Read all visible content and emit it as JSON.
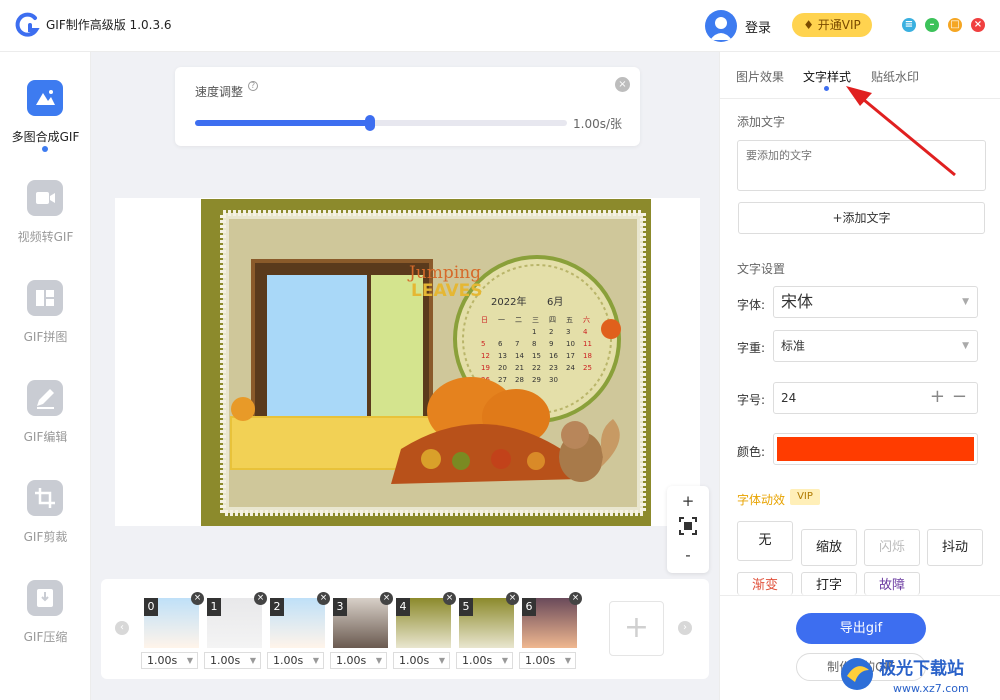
{
  "app": {
    "title": "GIF制作高级版 1.0.3.6",
    "login": "登录",
    "vip_button": "开通VIP"
  },
  "sidebar": {
    "items": [
      {
        "label": "多图合成GIF",
        "icon": "images-icon",
        "active": true
      },
      {
        "label": "视频转GIF",
        "icon": "video-icon",
        "active": false
      },
      {
        "label": "GIF拼图",
        "icon": "collage-icon",
        "active": false
      },
      {
        "label": "GIF编辑",
        "icon": "edit-icon",
        "active": false
      },
      {
        "label": "GIF剪裁",
        "icon": "crop-icon",
        "active": false
      },
      {
        "label": "GIF压缩",
        "icon": "compress-icon",
        "active": false
      }
    ]
  },
  "speed": {
    "title": "速度调整",
    "value": "1.00s/张",
    "level": 0.47
  },
  "preview": {
    "calendar_year": "2022年",
    "calendar_month": "6月",
    "weekdays": [
      "日",
      "一",
      "二",
      "三",
      "四",
      "五",
      "六"
    ],
    "days": [
      "1",
      "2",
      "3",
      "4",
      "5",
      "6",
      "7",
      "8",
      "9",
      "10",
      "11",
      "12",
      "13",
      "14",
      "15",
      "16",
      "17",
      "18",
      "19",
      "20",
      "21",
      "22",
      "23",
      "24",
      "25",
      "26",
      "27",
      "28",
      "29",
      "30"
    ],
    "headline_1": "Jumping",
    "headline_2": "LEAVES"
  },
  "zoom": {
    "in": "+",
    "out": "-"
  },
  "frames": [
    {
      "index": "0",
      "duration": "1.00s"
    },
    {
      "index": "1",
      "duration": "1.00s"
    },
    {
      "index": "2",
      "duration": "1.00s"
    },
    {
      "index": "3",
      "duration": "1.00s"
    },
    {
      "index": "4",
      "duration": "1.00s"
    },
    {
      "index": "5",
      "duration": "1.00s"
    },
    {
      "index": "6",
      "duration": "1.00s"
    }
  ],
  "panel": {
    "tabs": [
      "图片效果",
      "文字样式",
      "贴纸水印"
    ],
    "active_tab": "文字样式",
    "add_text_label": "添加文字",
    "text_placeholder": "要添加的文字",
    "add_text_button": "+添加文字",
    "text_settings_label": "文字设置",
    "font_label": "字体:",
    "font_value": "宋体",
    "weight_label": "字重:",
    "weight_value": "标准",
    "size_label": "字号:",
    "size_value": "24",
    "color_label": "颜色:",
    "color_value": "#ff3c00",
    "anim_label": "字体动效",
    "vip_tag": "VIP",
    "animations": [
      "无",
      "缩放",
      "闪烁",
      "抖动",
      "渐变",
      "打字",
      "故障"
    ],
    "export_button": "导出gif",
    "make_new_button": "制作新的GIF"
  },
  "watermark": {
    "brand": "极光下载站",
    "url": "www.xz7.com"
  }
}
